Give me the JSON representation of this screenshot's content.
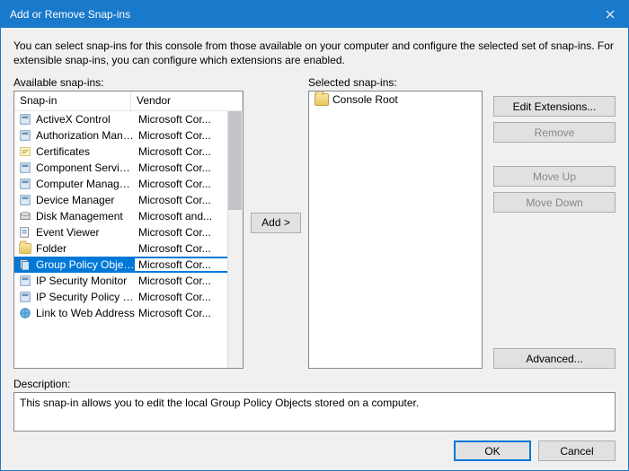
{
  "window": {
    "title": "Add or Remove Snap-ins",
    "intro": "You can select snap-ins for this console from those available on your computer and configure the selected set of snap-ins. For extensible snap-ins, you can configure which extensions are enabled."
  },
  "labels": {
    "available": "Available snap-ins:",
    "selected": "Selected snap-ins:",
    "description": "Description:"
  },
  "headers": {
    "snapin": "Snap-in",
    "vendor": "Vendor"
  },
  "buttons": {
    "add": "Add >",
    "edit_ext": "Edit Extensions...",
    "remove": "Remove",
    "move_up": "Move Up",
    "move_down": "Move Down",
    "advanced": "Advanced...",
    "ok": "OK",
    "cancel": "Cancel"
  },
  "snapins": [
    {
      "name": "ActiveX Control",
      "vendor": "Microsoft Cor...",
      "icon": "activex",
      "selected": false
    },
    {
      "name": "Authorization Manager",
      "vendor": "Microsoft Cor...",
      "icon": "authz",
      "selected": false
    },
    {
      "name": "Certificates",
      "vendor": "Microsoft Cor...",
      "icon": "cert",
      "selected": false
    },
    {
      "name": "Component Services",
      "vendor": "Microsoft Cor...",
      "icon": "comp",
      "selected": false
    },
    {
      "name": "Computer Managem...",
      "vendor": "Microsoft Cor...",
      "icon": "mgmt",
      "selected": false
    },
    {
      "name": "Device Manager",
      "vendor": "Microsoft Cor...",
      "icon": "device",
      "selected": false
    },
    {
      "name": "Disk Management",
      "vendor": "Microsoft and...",
      "icon": "disk",
      "selected": false
    },
    {
      "name": "Event Viewer",
      "vendor": "Microsoft Cor...",
      "icon": "event",
      "selected": false
    },
    {
      "name": "Folder",
      "vendor": "Microsoft Cor...",
      "icon": "folder",
      "selected": false
    },
    {
      "name": "Group Policy Object ...",
      "vendor": "Microsoft Cor...",
      "icon": "gpo",
      "selected": true
    },
    {
      "name": "IP Security Monitor",
      "vendor": "Microsoft Cor...",
      "icon": "ipsec",
      "selected": false
    },
    {
      "name": "IP Security Policy M...",
      "vendor": "Microsoft Cor...",
      "icon": "ipsecpol",
      "selected": false
    },
    {
      "name": "Link to Web Address",
      "vendor": "Microsoft Cor...",
      "icon": "link",
      "selected": false
    }
  ],
  "selected_tree": {
    "root": "Console Root"
  },
  "description_text": "This snap-in allows you to edit the local Group Policy Objects stored on a computer.",
  "colors": {
    "titlebar": "#1979ca",
    "selection": "#0078d7"
  }
}
